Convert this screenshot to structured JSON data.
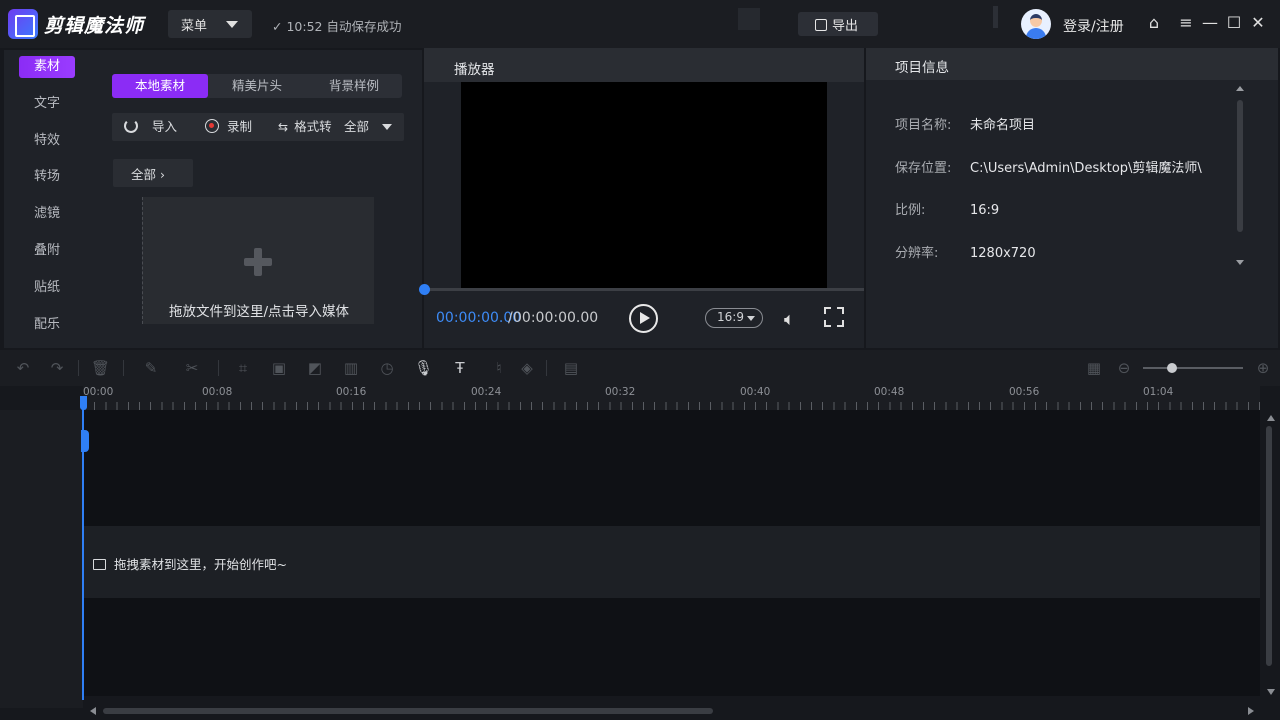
{
  "app": {
    "title": "剪辑魔法师"
  },
  "header": {
    "menu_label": "菜单",
    "autosave_time": "10:52",
    "autosave_text": "自动保存成功",
    "export_label": "导出",
    "login_label": "登录/注册"
  },
  "leftnav": {
    "items": [
      {
        "label": "素材",
        "active": true
      },
      {
        "label": "文字"
      },
      {
        "label": "特效"
      },
      {
        "label": "转场"
      },
      {
        "label": "滤镜"
      },
      {
        "label": "叠附"
      },
      {
        "label": "贴纸"
      },
      {
        "label": "配乐"
      }
    ]
  },
  "media": {
    "tabs": [
      "本地素材",
      "精美片头",
      "背景样例"
    ],
    "import_label": "导入",
    "record_label": "录制",
    "convert_label": "格式转",
    "format_value": "全部",
    "filter_label": "全部",
    "drop_hint": "拖放文件到这里/点击导入媒体"
  },
  "player": {
    "title": "播放器",
    "current_time": "00:00:00.00",
    "separator": " / ",
    "total_time": "00:00:00.00",
    "ratio": "16:9"
  },
  "info": {
    "title": "项目信息",
    "rows": [
      {
        "key": "项目名称:",
        "value": "未命名项目"
      },
      {
        "key": "保存位置:",
        "value": "C:\\Users\\Admin\\Desktop\\剪辑魔法师\\"
      },
      {
        "key": "比例:",
        "value": "16:9"
      },
      {
        "key": "分辨率:",
        "value": "1280x720"
      }
    ]
  },
  "timeline": {
    "ticks": [
      "00:00",
      "00:08",
      "00:16",
      "00:24",
      "00:32",
      "00:40",
      "00:48",
      "00:56",
      "01:04"
    ],
    "drag_hint": "拖拽素材到这里，开始创作吧~"
  },
  "colors": {
    "accent": "#8b2cf5",
    "playhead": "#2f7ff5"
  }
}
